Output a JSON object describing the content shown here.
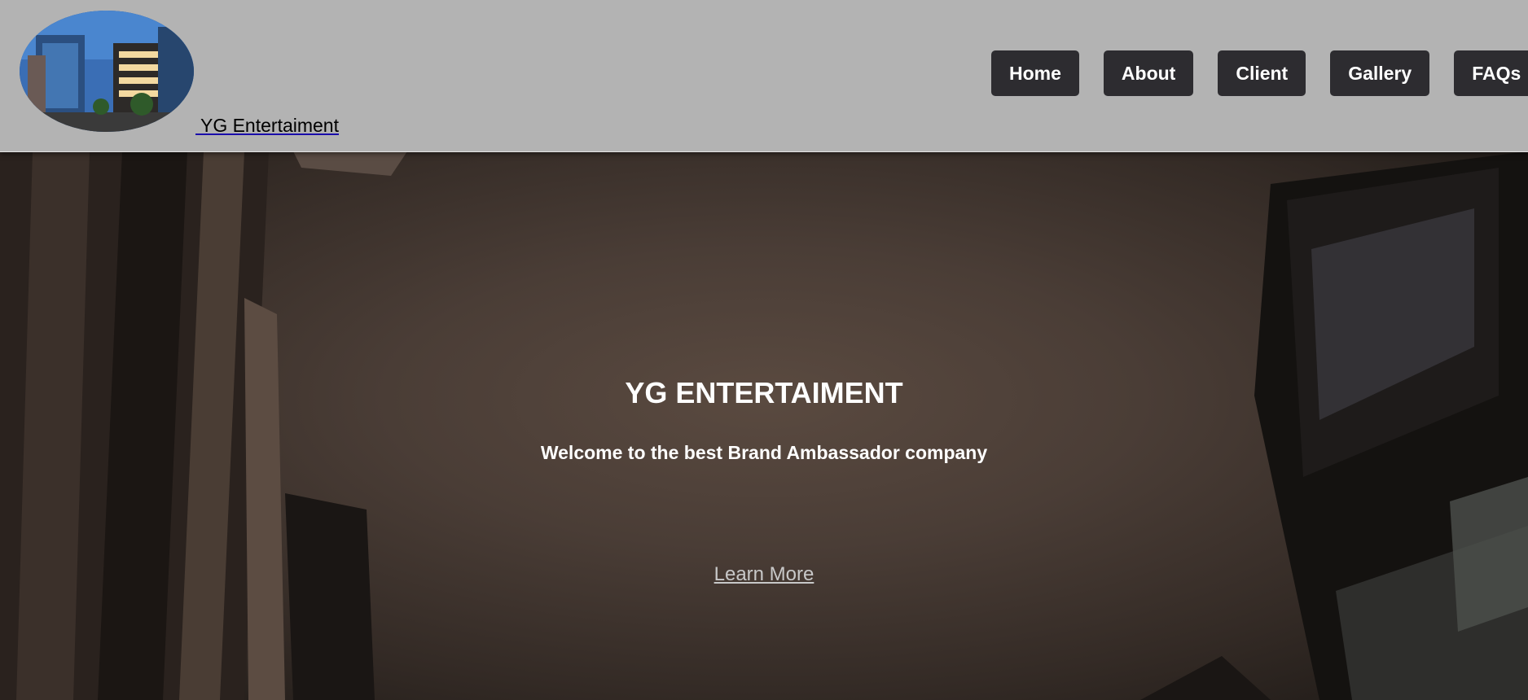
{
  "header": {
    "brand_text": " YG Entertaiment",
    "nav": [
      {
        "label": "Home"
      },
      {
        "label": "About"
      },
      {
        "label": "Client"
      },
      {
        "label": "Gallery"
      },
      {
        "label": "FAQs"
      }
    ]
  },
  "hero": {
    "title": "YG ENTERTAIMENT",
    "subtitle": "Welcome to the best Brand Ambassador company",
    "cta": "Learn More"
  },
  "colors": {
    "header_bg": "#b3b3b3",
    "nav_button_bg": "#2d2c30",
    "nav_button_text": "#ffffff",
    "hero_text": "#ffffff",
    "cta_text": "#c8c8c8"
  },
  "icons": {
    "logo": "building-logo-image"
  }
}
